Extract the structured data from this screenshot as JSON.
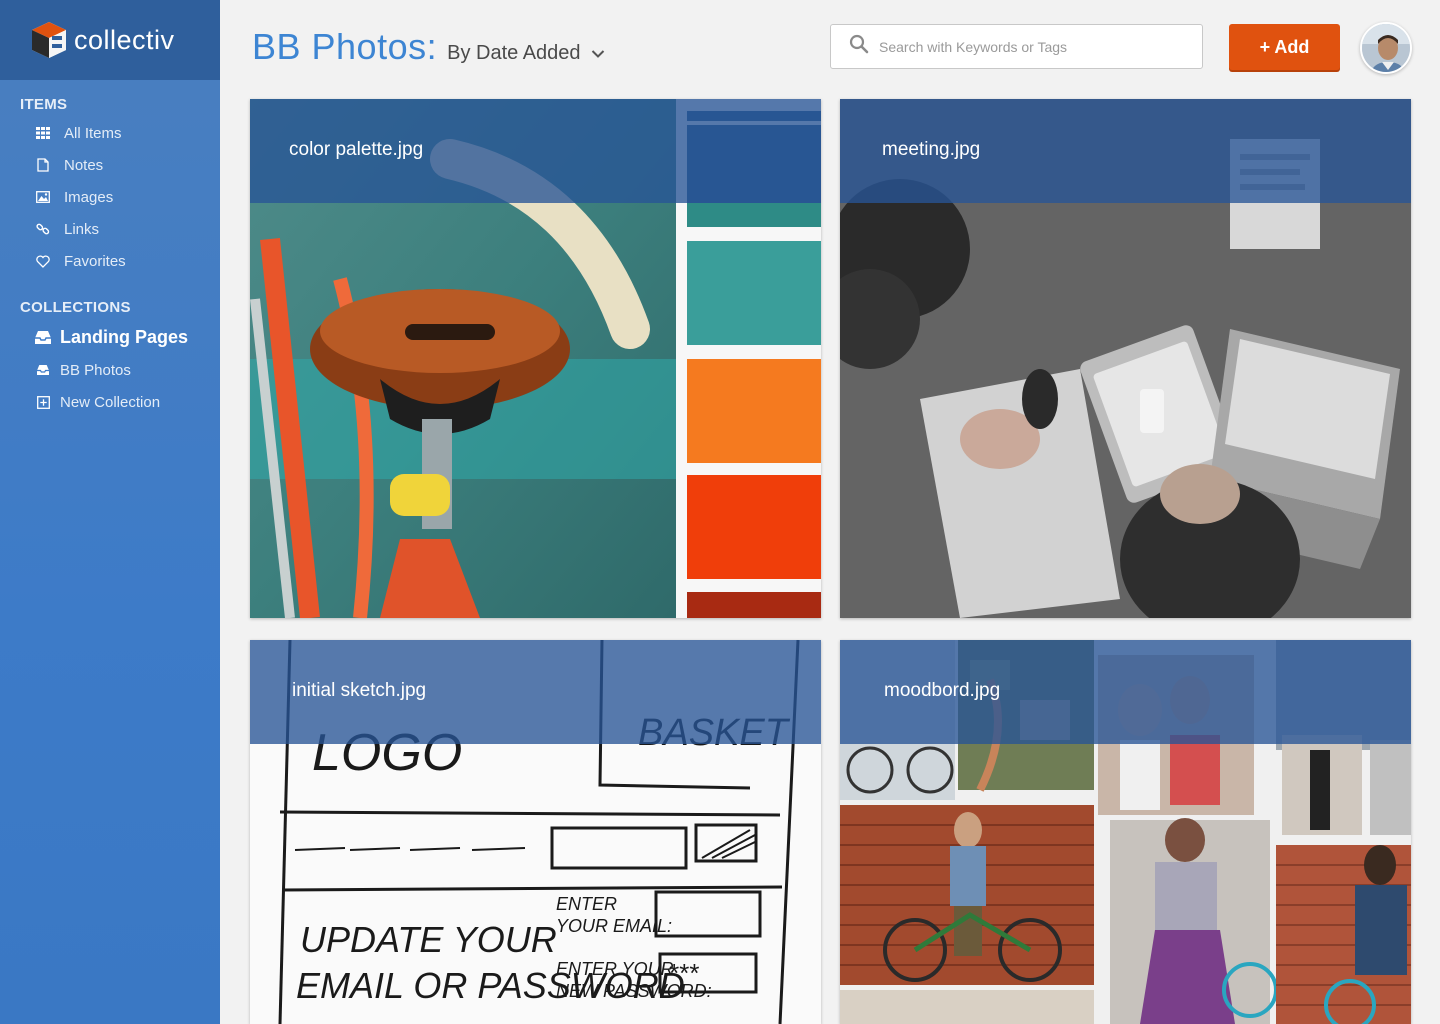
{
  "app": {
    "name": "collectiv"
  },
  "sidebar": {
    "items_title": "ITEMS",
    "items": [
      {
        "label": "All Items",
        "icon": "grid-icon"
      },
      {
        "label": "Notes",
        "icon": "document-icon"
      },
      {
        "label": "Images",
        "icon": "image-icon"
      },
      {
        "label": "Links",
        "icon": "link-icon"
      },
      {
        "label": "Favorites",
        "icon": "heart-icon"
      }
    ],
    "collections_title": "COLLECTIONS",
    "collections": [
      {
        "label": "Landing Pages",
        "icon": "inbox-icon",
        "active": true
      },
      {
        "label": "BB Photos",
        "icon": "inbox-icon",
        "active": false
      },
      {
        "label": "New Collection",
        "icon": "plus-square-icon",
        "active": false
      }
    ]
  },
  "header": {
    "title": "BB Photos:",
    "sort_label": "By Date Added"
  },
  "search": {
    "placeholder": "Search with Keywords or Tags"
  },
  "toolbar": {
    "add_label": "+ Add"
  },
  "cards": [
    {
      "label": "color palette.jpg"
    },
    {
      "label": "meeting.jpg"
    },
    {
      "label": "initial sketch.jpg"
    },
    {
      "label": "moodbord.jpg"
    }
  ],
  "sketch": {
    "logo": "LOGO",
    "basket": "BASKET",
    "update": "UPDATE YOUR",
    "email_pw": "EMAIL OR PASSWORD",
    "enter_email_1": "ENTER",
    "enter_email_2": "YOUR EMAIL:",
    "enter_pw_1": "ENTER YOUR",
    "enter_pw_2": "NEW PASSWORD:",
    "pw_mask": "***"
  },
  "colors": {
    "sidebar": "#3d7bc8",
    "logo_bar": "#2f5f9c",
    "title_blue": "#3d85d3",
    "add_button": "#e0520f",
    "palette": [
      "#2b5a8a",
      "#2e8b86",
      "#3a9e9a",
      "#f57a1f",
      "#f03e0a",
      "#a82a12"
    ]
  }
}
